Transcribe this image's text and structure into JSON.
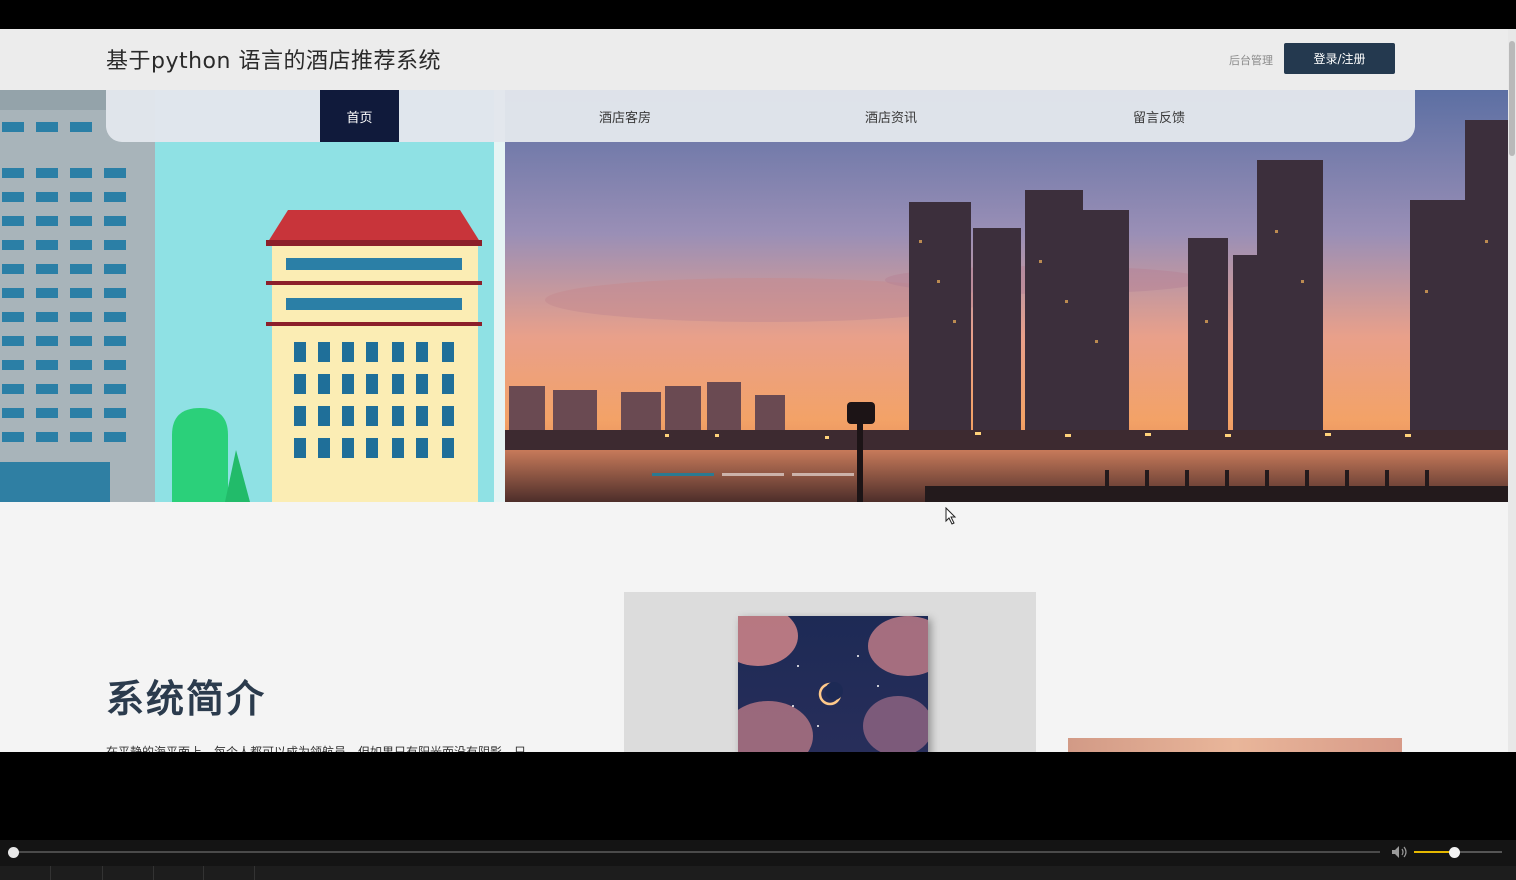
{
  "header": {
    "site_title": "基于python 语言的酒店推荐系统",
    "admin_link": "后台管理",
    "login_button": "登录/注册"
  },
  "nav": {
    "items": [
      {
        "label": "首页",
        "active": true
      },
      {
        "label": "酒店客房",
        "active": false
      },
      {
        "label": "酒店资讯",
        "active": false
      },
      {
        "label": "留言反馈",
        "active": false
      }
    ]
  },
  "hero": {
    "slider_count": 3,
    "active_slide": 0
  },
  "about": {
    "title": "系统简介",
    "text": "在平静的海平面上，每个人都可以成为领航员，但如果只有阳光而没有阴影，只"
  },
  "player": {
    "progress": 0,
    "volume": 0.45
  },
  "colors": {
    "nav_active": "#101a3b",
    "login_button": "#24394f",
    "title_text": "#2b3b4d",
    "volume_fill": "#e5b800"
  }
}
